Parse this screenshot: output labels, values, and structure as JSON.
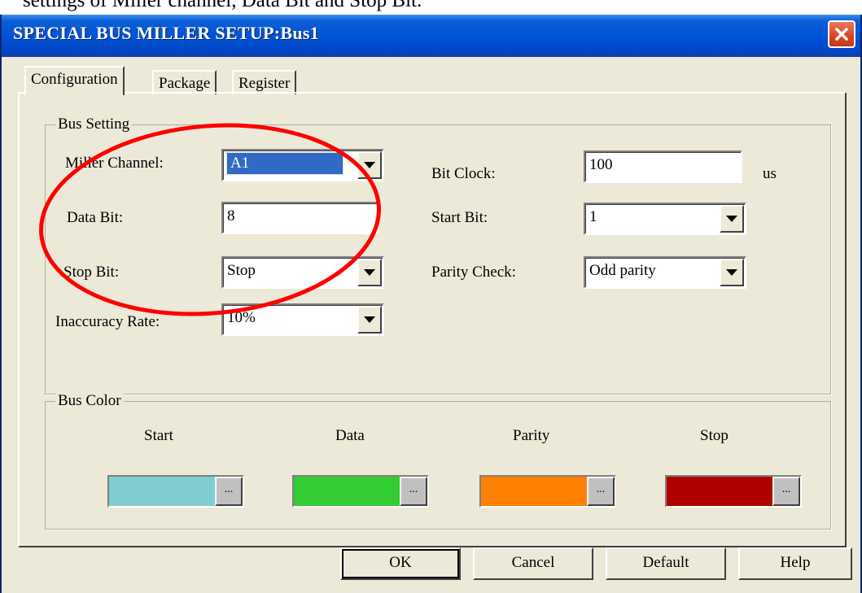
{
  "document": {
    "caption_fragment": "settings of Miller channel, Data Bit and Stop Bit."
  },
  "window": {
    "title": "SPECIAL BUS MILLER SETUP:Bus1",
    "titlebar_color": "#0052d6",
    "close_icon": "close-x-icon"
  },
  "tabs": [
    {
      "label": "Configuration",
      "active": true
    },
    {
      "label": "Package",
      "active": false
    },
    {
      "label": "Register",
      "active": false
    }
  ],
  "bus_setting": {
    "title": "Bus Setting",
    "miller_channel": {
      "label": "Miller Channel:",
      "value": "A1"
    },
    "data_bit": {
      "label": "Data Bit:",
      "value": "8"
    },
    "stop_bit": {
      "label": "Stop Bit:",
      "value": "Stop"
    },
    "inaccuracy_rate": {
      "label": "Inaccuracy Rate:",
      "value": "10%"
    },
    "bit_clock": {
      "label": "Bit Clock:",
      "value": "100",
      "unit": "us"
    },
    "start_bit": {
      "label": "Start Bit:",
      "value": "1"
    },
    "parity_check": {
      "label": "Parity Check:",
      "value": "Odd parity"
    }
  },
  "bus_color": {
    "title": "Bus Color",
    "items": [
      {
        "label": "Start",
        "color": "#80cdd0",
        "button": "..."
      },
      {
        "label": "Data",
        "color": "#33cc33",
        "button": "..."
      },
      {
        "label": "Parity",
        "color": "#ff8000",
        "button": "..."
      },
      {
        "label": "Stop",
        "color": "#b00000",
        "button": "..."
      }
    ]
  },
  "buttons": {
    "ok": "OK",
    "cancel": "Cancel",
    "default": "Default",
    "help": "Help"
  },
  "annotation": {
    "shape": "ellipse",
    "color": "#ff0000",
    "highlights": [
      "Miller Channel",
      "Data Bit",
      "Stop Bit"
    ]
  }
}
